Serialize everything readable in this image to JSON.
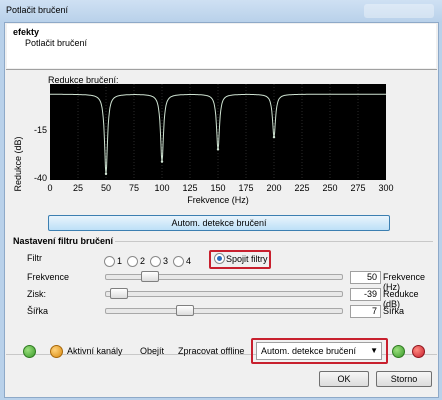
{
  "window": {
    "title": "Potlačit bručení"
  },
  "effects": {
    "heading": "efekty",
    "item": "Potlačit bručení"
  },
  "graph": {
    "label": "Redukce bručení:",
    "ylabel": "Redukce (dB)",
    "yticks": [
      "-15",
      "-40"
    ],
    "xticks": [
      "0",
      "25",
      "50",
      "75",
      "100",
      "125",
      "150",
      "175",
      "200",
      "225",
      "250",
      "275",
      "300"
    ],
    "xlabel": "Frekvence (Hz)"
  },
  "chart_data": {
    "type": "line",
    "xlabel": "Frekvence (Hz)",
    "ylabel": "Redukce (dB)",
    "xlim": [
      0,
      300
    ],
    "ylim": [
      -42,
      5
    ],
    "notches": [
      {
        "x": 50,
        "depth": -39
      },
      {
        "x": 100,
        "depth": -33
      },
      {
        "x": 150,
        "depth": -27
      },
      {
        "x": 200,
        "depth": -21
      }
    ],
    "grid": true,
    "line_color": "#cfe3d2"
  },
  "detect_button": {
    "label": "Autom. detekce bručení"
  },
  "filter_settings": {
    "title": "Nastavení filtru bručení",
    "filter_label": "Filtr",
    "radios": [
      {
        "label": "1",
        "selected": false
      },
      {
        "label": "2",
        "selected": false
      },
      {
        "label": "3",
        "selected": false
      },
      {
        "label": "4",
        "selected": false
      },
      {
        "label": "Spojit filtry",
        "selected": true
      }
    ],
    "sliders": [
      {
        "label": "Frekvence",
        "value": "50",
        "unit": "Frekvence (Hz)",
        "position": 0.17
      },
      {
        "label": "Zisk:",
        "value": "-39",
        "unit": "Redukce (dB)",
        "position": 0.03
      },
      {
        "label": "Šířka",
        "value": "7",
        "unit": "Šířka",
        "position": 0.33
      }
    ]
  },
  "bottom": {
    "active_channels": "Aktivní kanály",
    "bypass": "Obejít",
    "process_offline": "Zpracovat offline",
    "preset": "Autom. detekce bručení",
    "ok": "OK",
    "cancel": "Storno"
  },
  "colors": {
    "accent": "#3c7fb1",
    "highlight": "#c8202e",
    "plot_bg": "#000000"
  }
}
